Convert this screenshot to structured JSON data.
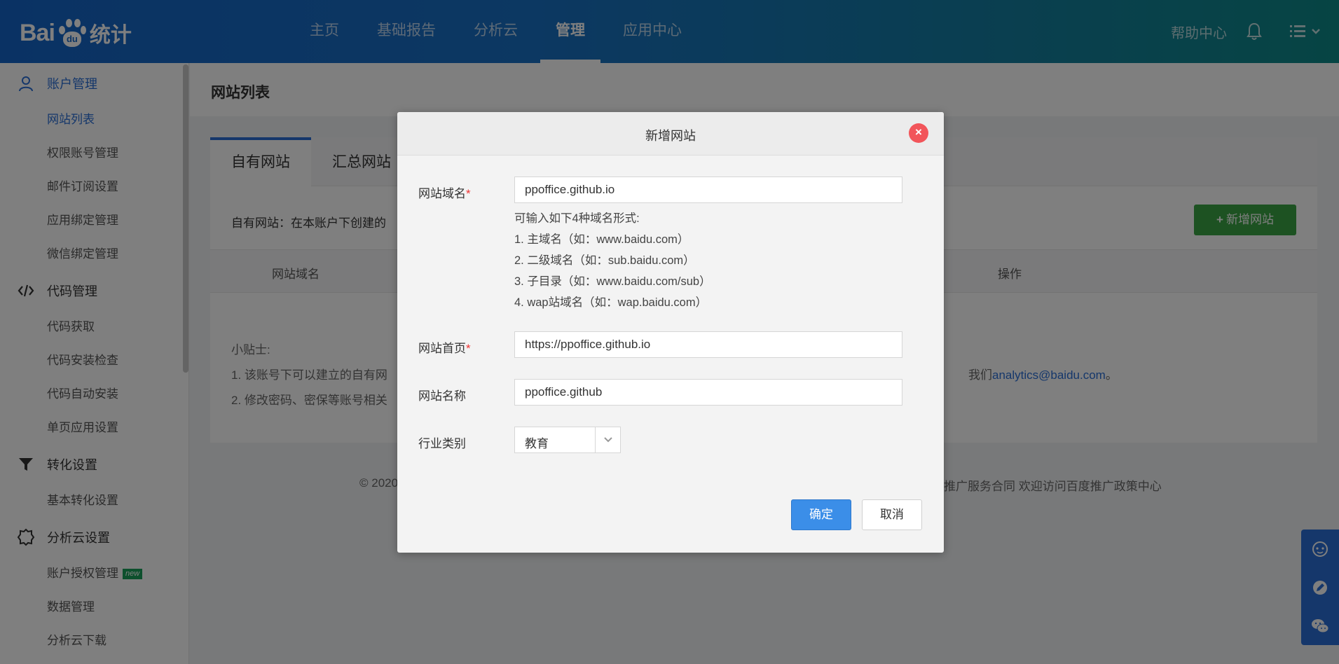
{
  "header": {
    "logo_text_bai": "Bai",
    "logo_text_du": "du",
    "logo_text_tongji": "统计",
    "nav": [
      "主页",
      "基础报告",
      "分析云",
      "管理",
      "应用中心"
    ],
    "active_nav": "管理",
    "help": "帮助中心"
  },
  "sidebar": {
    "sections": [
      {
        "label": "账户管理",
        "icon": "user-icon",
        "items": [
          "网站列表",
          "权限账号管理",
          "邮件订阅设置",
          "应用绑定管理",
          "微信绑定管理"
        ]
      },
      {
        "label": "代码管理",
        "icon": "code-icon",
        "items": [
          "代码获取",
          "代码安装检查",
          "代码自动安装",
          "单页应用设置"
        ]
      },
      {
        "label": "转化设置",
        "icon": "funnel-icon",
        "items": [
          "基本转化设置"
        ]
      },
      {
        "label": "分析云设置",
        "icon": "cloud-gear-icon",
        "items": [
          "账户授权管理",
          "数据管理",
          "分析云下载"
        ]
      }
    ],
    "active_item": "网站列表",
    "new_badge": "new"
  },
  "main": {
    "page_title": "网站列表",
    "tabs": [
      "自有网站",
      "汇总网站"
    ],
    "desc": "自有网站：在本账户下创建的",
    "add_button": "新增网站",
    "add_icon": "+",
    "table_headers": [
      "网站域名",
      "操作"
    ],
    "tips_title": "小贴士:",
    "tip1": "1. 该账号下可以建立的自有网",
    "tip1_tail": "我们",
    "tip_email": "analytics@baidu.com",
    "tip1_end": "。",
    "tip2": "2. 修改密码、密保等账号相关",
    "footer_left": "© 2020",
    "footer_right": "推广服务合同 欢迎访问百度推广政策中心"
  },
  "modal": {
    "title": "新增网站",
    "close": "×",
    "domain_label": "网站域名",
    "domain_value": "ppoffice.github.io",
    "hint_lines": [
      "可输入如下4种域名形式:",
      "1. 主域名（如：www.baidu.com）",
      "2. 二级域名（如：sub.baidu.com）",
      "3. 子目录（如：www.baidu.com/sub）",
      "4. wap站域名（如：wap.baidu.com）"
    ],
    "homepage_label": "网站首页",
    "homepage_value": "https://ppoffice.github.io",
    "name_label": "网站名称",
    "name_value": "ppoffice.github",
    "industry_label": "行业类别",
    "industry_value": "教育",
    "required_mark": "*",
    "ok": "确定",
    "cancel": "取消"
  },
  "colors": {
    "accent": "#2a6fd6",
    "add_green": "#3aa544",
    "close_red": "#f2555a"
  }
}
